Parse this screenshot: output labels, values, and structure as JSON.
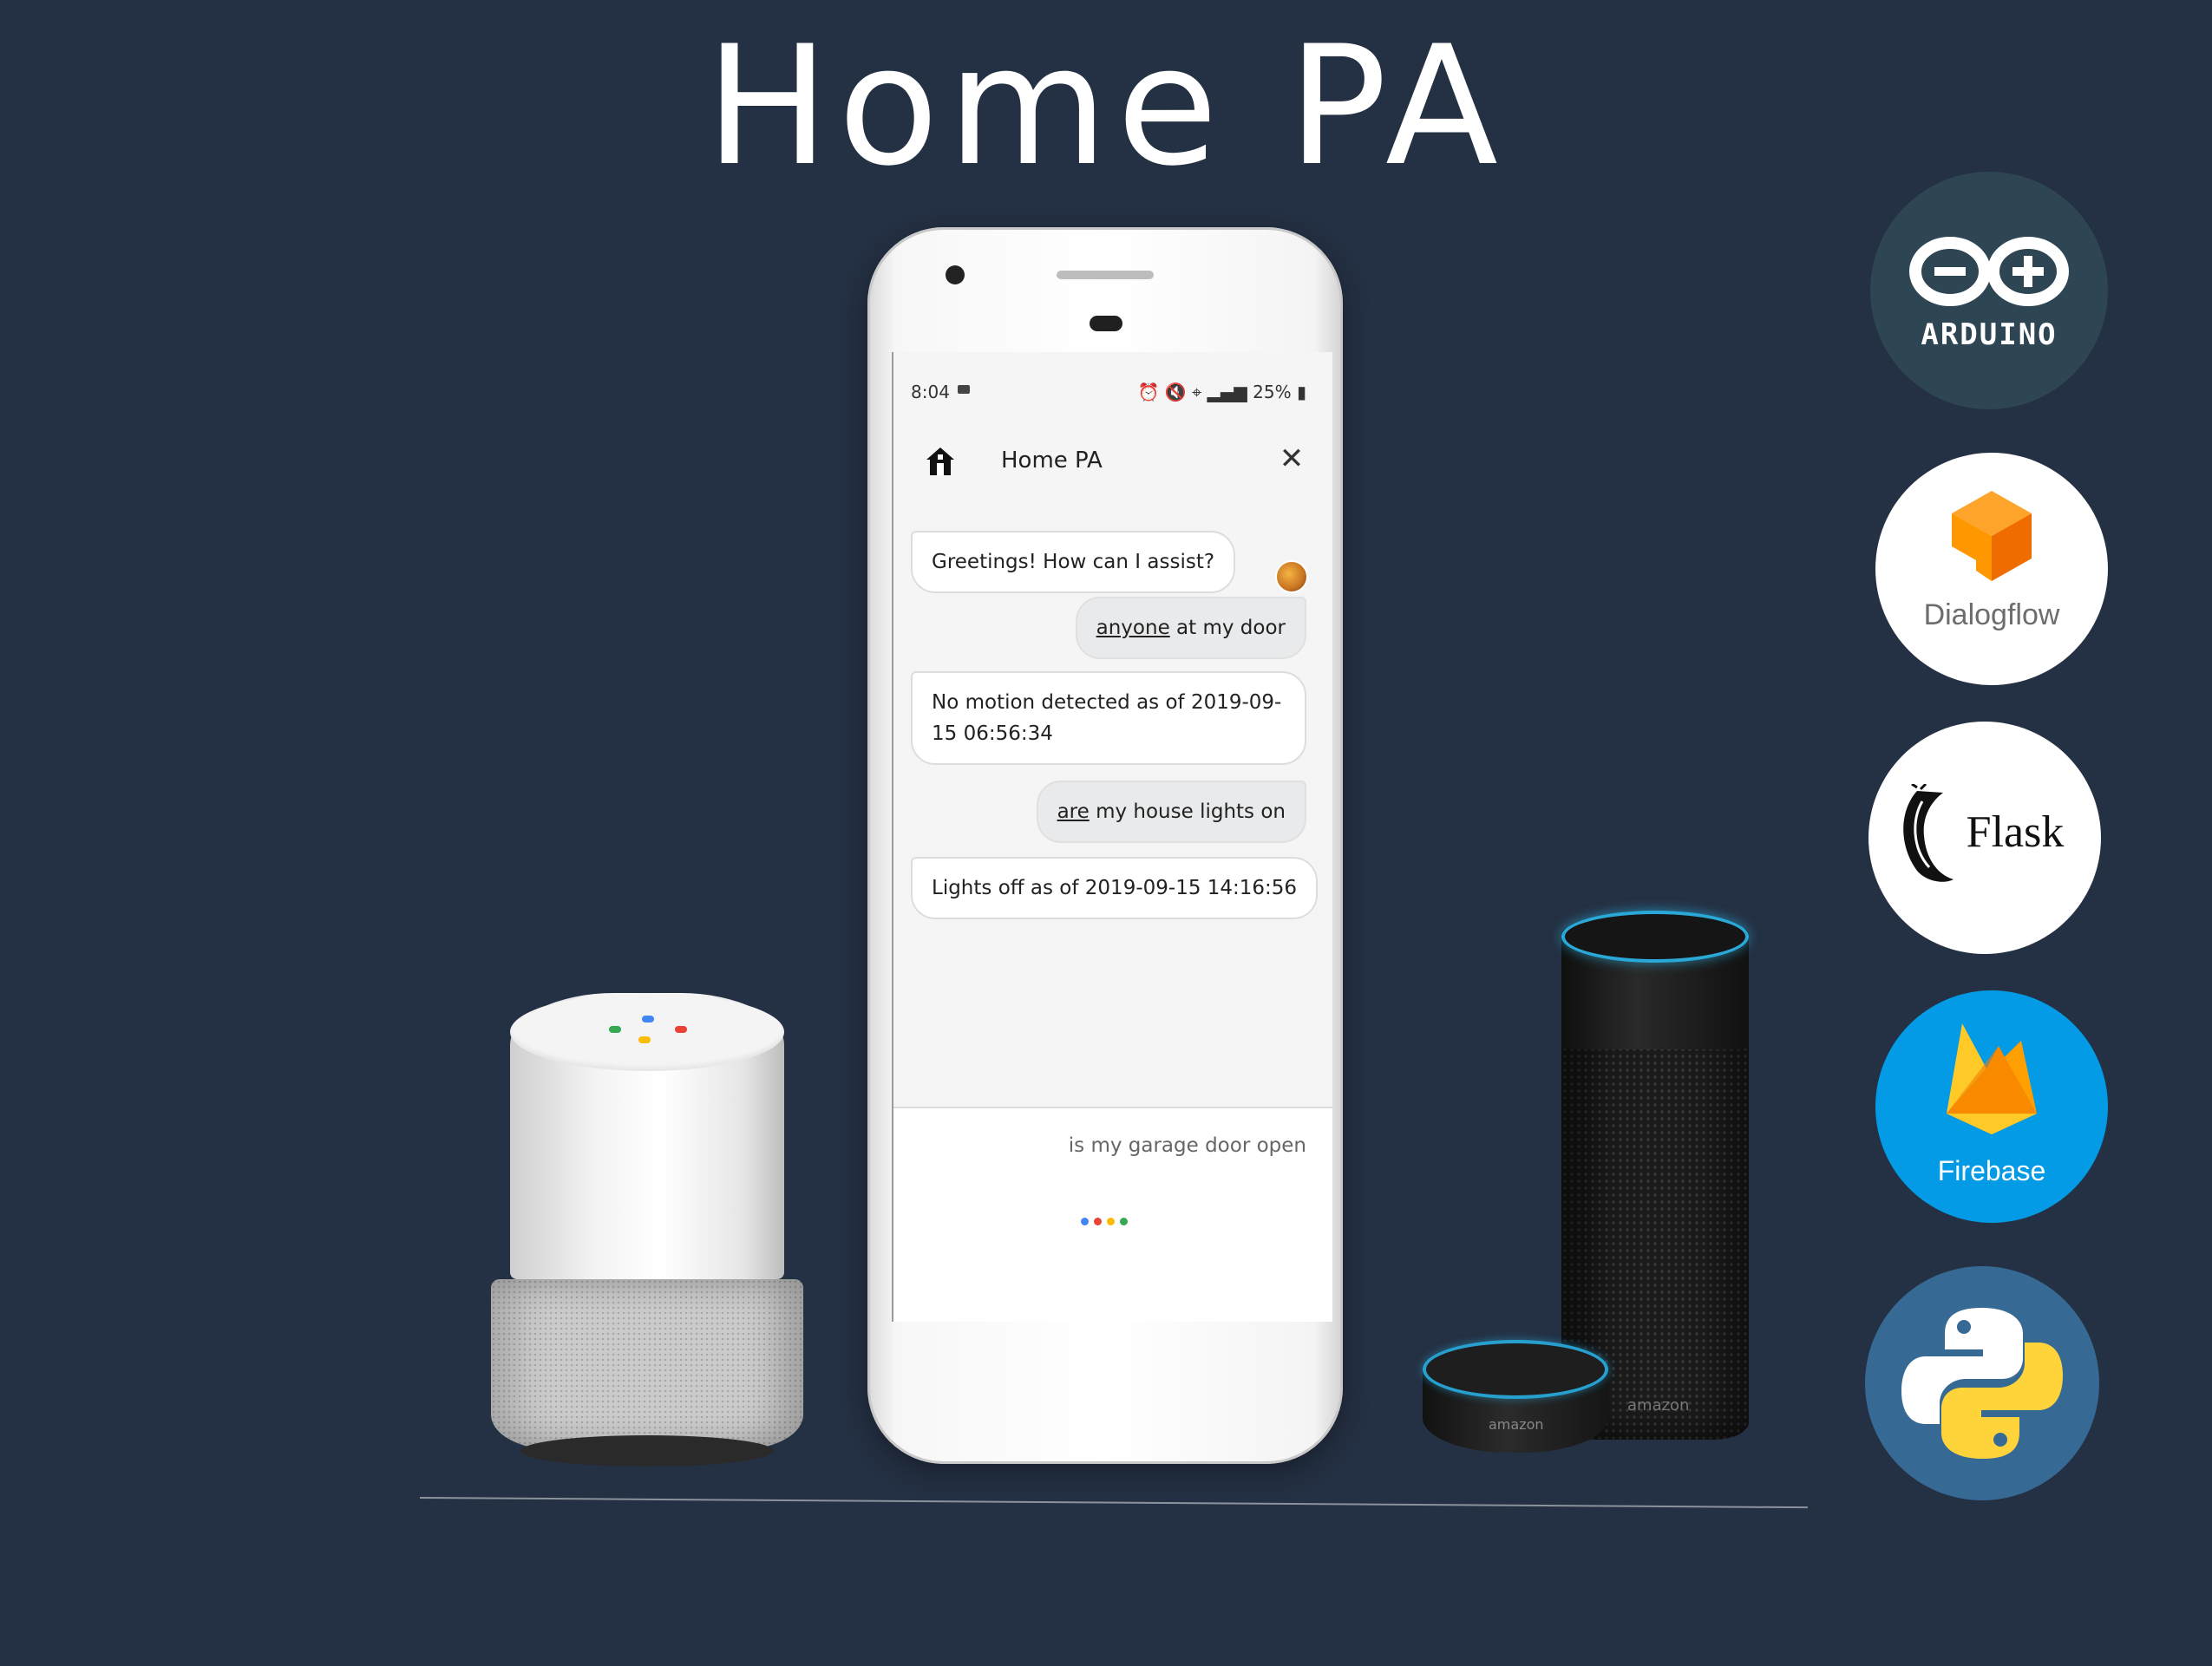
{
  "title": "Home PA",
  "phone": {
    "status": {
      "time": "8:04",
      "battery": "25%"
    },
    "app_title": "Home PA",
    "messages": [
      {
        "from": "bot",
        "text": "Greetings! How can I assist?"
      },
      {
        "from": "user",
        "first_word": "anyone",
        "rest": " at my door"
      },
      {
        "from": "bot",
        "text": "No motion detected as of 2019-09-15 06:56:34"
      },
      {
        "from": "user",
        "first_word": "are",
        "rest": " my house lights on"
      },
      {
        "from": "bot",
        "text": "Lights off as of 2019-09-15 14:16:56"
      }
    ],
    "voice_query": "is my garage door open",
    "mic_dot_colors": [
      "#4285f4",
      "#ea4335",
      "#fbbc05",
      "#34a853"
    ]
  },
  "devices": {
    "google_home_led_colors": [
      "#34a853",
      "#4285f4",
      "#fbbc05",
      "#ea4335"
    ],
    "echo_brand": "amazon",
    "dot_brand": "amazon"
  },
  "logos": {
    "arduino": "ARDUINO",
    "dialogflow": "Dialogflow",
    "flask": "Flask",
    "firebase": "Firebase",
    "python_icon": "python-icon"
  },
  "colors": {
    "background": "#243043",
    "arduino": "#2e4554",
    "firebase": "#039be5",
    "python": "#366994",
    "alexa_ring": "#2aa9d8"
  }
}
